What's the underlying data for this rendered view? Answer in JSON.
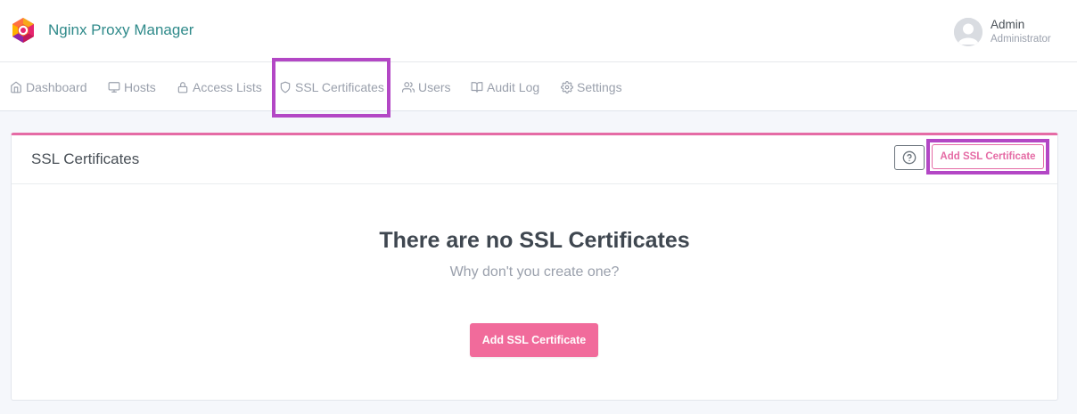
{
  "app": {
    "brand_name": "Nginx Proxy Manager",
    "logo_icon": "nginx-proxy-manager-logo"
  },
  "user": {
    "name": "Admin",
    "role": "Administrator",
    "avatar_icon": "default-user-avatar"
  },
  "nav": {
    "items": [
      {
        "label": "Dashboard",
        "icon": "home-icon"
      },
      {
        "label": "Hosts",
        "icon": "monitor-icon"
      },
      {
        "label": "Access Lists",
        "icon": "lock-icon"
      },
      {
        "label": "SSL Certificates",
        "icon": "shield-icon",
        "active": true
      },
      {
        "label": "Users",
        "icon": "users-icon"
      },
      {
        "label": "Audit Log",
        "icon": "book-open-icon"
      },
      {
        "label": "Settings",
        "icon": "gear-icon"
      }
    ]
  },
  "card": {
    "title": "SSL Certificates",
    "help_icon": "help-circle-icon",
    "add_button_label": "Add SSL Certificate"
  },
  "empty_state": {
    "title": "There are no SSL Certificates",
    "subtitle": "Why don't you create one?",
    "button_label": "Add SSL Certificate"
  },
  "colors": {
    "accent_pink": "#e56ba5",
    "primary_button": "#f16b9b",
    "brand_text": "#2f8a8a",
    "highlight_box": "#b347c5"
  }
}
